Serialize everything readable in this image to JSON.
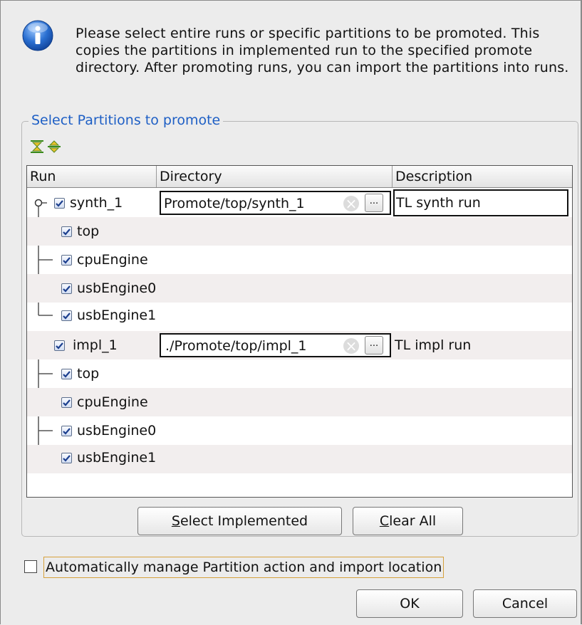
{
  "info": {
    "icon": "info-icon",
    "message": "Please select entire runs or specific partitions to be promoted. This copies the partitions in implemented run to the specified promote directory. After promoting runs, you can import the partitions into runs."
  },
  "group": {
    "title": "Select Partitions to promote"
  },
  "toolbar": {
    "expand_icon": "expand-all-icon",
    "collapse_icon": "collapse-all-icon"
  },
  "table": {
    "columns": [
      "Run",
      "Directory",
      "Description"
    ],
    "runs": [
      {
        "name": "synth_1",
        "checked": true,
        "directory": "Promote/top/synth_1",
        "description": "TL synth run",
        "partitions": [
          "top",
          "cpuEngine",
          "usbEngine0",
          "usbEngine1"
        ]
      },
      {
        "name": "impl_1",
        "checked": true,
        "directory": "./Promote/top/impl_1",
        "description": "TL impl run",
        "partitions": [
          "top",
          "cpuEngine",
          "usbEngine0",
          "usbEngine1"
        ]
      }
    ],
    "browse_label": "..."
  },
  "buttons": {
    "select_implemented": {
      "mnemonic": "S",
      "rest": "elect Implemented"
    },
    "clear_all": {
      "mnemonic": "C",
      "rest": "lear All"
    },
    "ok": "OK",
    "cancel": "Cancel"
  },
  "auto_manage": {
    "checked": false,
    "label": "Automatically manage Partition action and import location"
  },
  "colors": {
    "group_title": "#1e5fc5",
    "info_icon": "#2a6fd1",
    "row_alt": "#f2eeee"
  }
}
